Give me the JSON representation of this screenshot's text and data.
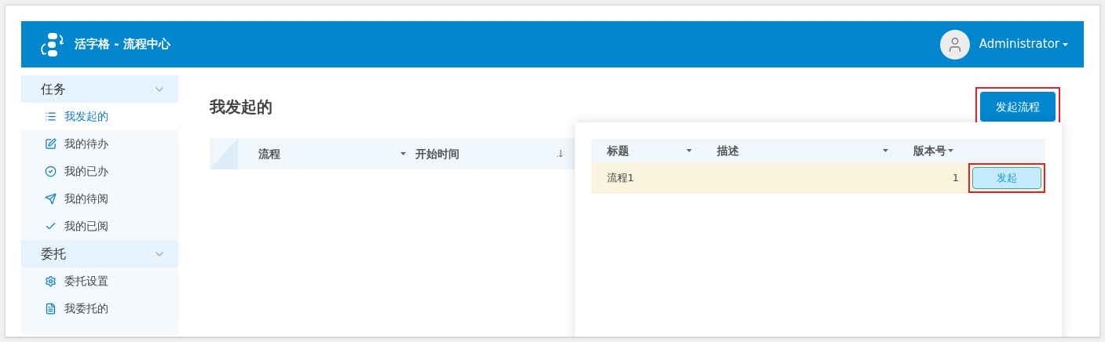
{
  "header": {
    "title": "活字格 - 流程中心",
    "user": "Administrator"
  },
  "sidebar": {
    "groups": [
      {
        "label": "任务",
        "expanded": true,
        "items": [
          {
            "label": "我发起的",
            "kind": "list",
            "selected": true
          },
          {
            "label": "我的待办",
            "kind": "edit",
            "selected": false
          },
          {
            "label": "我的已办",
            "kind": "check-circle",
            "selected": false
          },
          {
            "label": "我的待阅",
            "kind": "send",
            "selected": false
          },
          {
            "label": "我的已阅",
            "kind": "check",
            "selected": false
          }
        ]
      },
      {
        "label": "委托",
        "expanded": true,
        "items": [
          {
            "label": "委托设置",
            "kind": "gear",
            "selected": false
          },
          {
            "label": "我委托的",
            "kind": "document",
            "selected": false
          }
        ]
      }
    ]
  },
  "page": {
    "title": "我发起的",
    "start_button": {
      "label": "发起流程",
      "highlighted": true
    }
  },
  "table": {
    "columns": [
      {
        "label": "流程",
        "kind": "menu"
      },
      {
        "label": "开始时间",
        "kind": "sort"
      }
    ]
  },
  "popup": {
    "columns": [
      {
        "label": "标题",
        "menu": true
      },
      {
        "label": "描述",
        "menu": true
      },
      {
        "label": "版本号",
        "menu": true
      }
    ],
    "rows": [
      {
        "title": "流程1",
        "version": "1",
        "action": "发起",
        "highlighted": true,
        "selected": true
      }
    ]
  }
}
